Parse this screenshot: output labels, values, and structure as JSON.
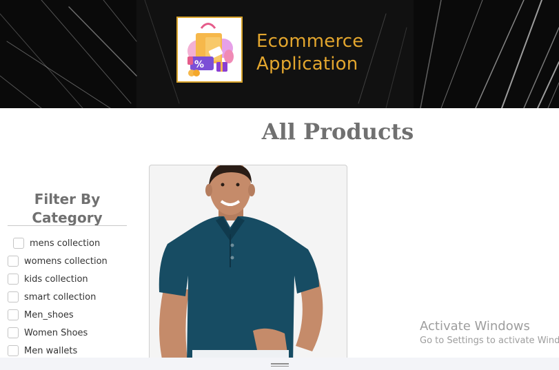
{
  "header": {
    "brand_line1": "Ecommerce",
    "brand_line2": "Application",
    "logo_icon": "shopping-bag-logo-icon",
    "accent_color": "#e3a62e"
  },
  "main": {
    "title": "All Products"
  },
  "sidebar": {
    "title_line1": "Filter By",
    "title_line2": "Category",
    "items": [
      {
        "label": "mens collection",
        "checked": false
      },
      {
        "label": "womens collection",
        "checked": false
      },
      {
        "label": "kids collection",
        "checked": false
      },
      {
        "label": "smart collection",
        "checked": false
      },
      {
        "label": "Men_shoes",
        "checked": false
      },
      {
        "label": "Women Shoes",
        "checked": false
      },
      {
        "label": "Men wallets",
        "checked": false
      }
    ]
  },
  "products": [
    {
      "image": "man-in-teal-polo-shirt"
    }
  ],
  "watermark": {
    "line1": "Activate Windows",
    "line2": "Go to Settings to activate Windows."
  }
}
